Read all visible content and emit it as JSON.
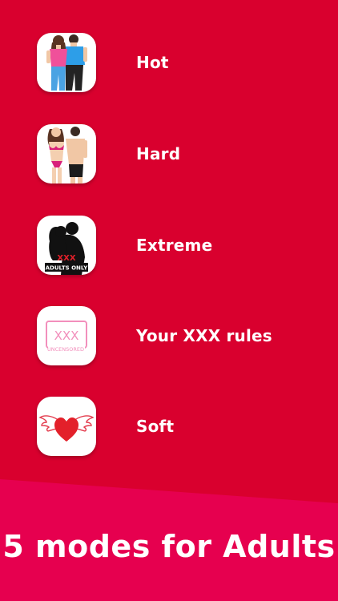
{
  "modes": [
    {
      "label": "Hot",
      "icon": "couple-casual-icon"
    },
    {
      "label": "Hard",
      "icon": "couple-underwear-icon"
    },
    {
      "label": "Extreme",
      "icon": "couple-silhouette-icon"
    },
    {
      "label": "Your XXX rules",
      "icon": "xxx-uncensored-icon"
    },
    {
      "label": "Soft",
      "icon": "winged-heart-icon"
    }
  ],
  "extreme_badge": {
    "top": "XXX",
    "bottom": "ADULTS ONLY"
  },
  "xxx_badge": {
    "main": "XXX",
    "sub": "UNCENSORED"
  },
  "tagline": "5 modes for Adults",
  "colors": {
    "background": "#D9002E",
    "banner": "#E6004F",
    "text": "#FFFFFF"
  }
}
